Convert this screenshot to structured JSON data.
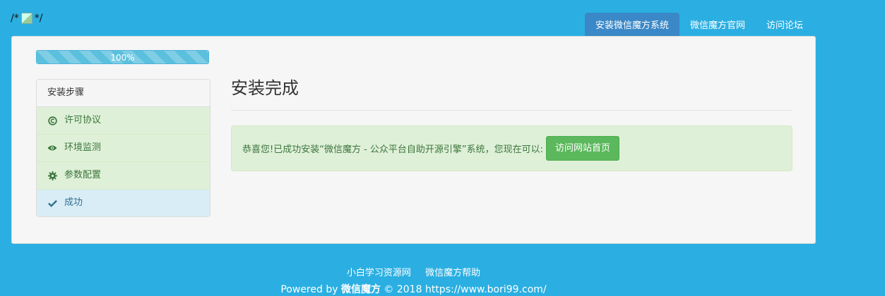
{
  "header": {
    "left_prefix": "/*",
    "left_suffix": "*/",
    "nav": [
      {
        "label": "安装微信魔方系统",
        "active": true
      },
      {
        "label": "微信魔方官网",
        "active": false
      },
      {
        "label": "访问论坛",
        "active": false
      }
    ]
  },
  "progress": {
    "label": "100%",
    "value": 100
  },
  "steps": {
    "heading": "安装步骤",
    "items": [
      {
        "label": "许可协议",
        "icon": "copyright-icon"
      },
      {
        "label": "环境监测",
        "icon": "eye-icon"
      },
      {
        "label": "参数配置",
        "icon": "gear-icon"
      },
      {
        "label": "成功",
        "icon": "check-icon"
      }
    ]
  },
  "main": {
    "title": "安装完成",
    "message": "恭喜您!已成功安装“微信魔方 - 公众平台自助开源引擎”系统，您现在可以:",
    "button": "访问网站首页"
  },
  "footer": {
    "links": [
      "小白学习资源网",
      "微信魔方帮助"
    ],
    "powered": "Powered by",
    "brand": "微信魔方",
    "copyright": "© 2018 https://www.bori99.com/"
  },
  "colors": {
    "background": "#2bafe2",
    "nav_active": "#3a88c7",
    "success": "#5cb85c",
    "progress": "#5bc0de"
  }
}
